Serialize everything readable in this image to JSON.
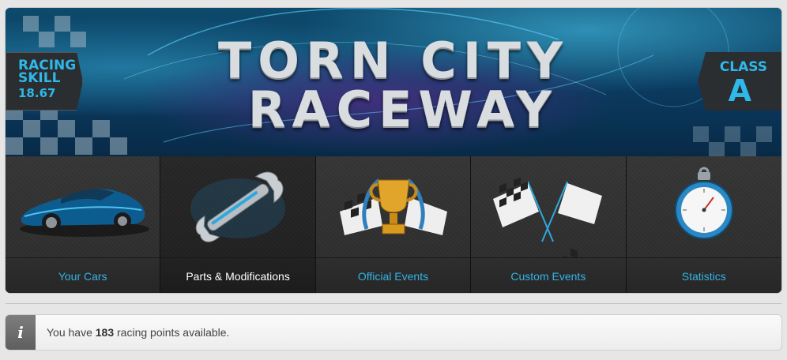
{
  "banner": {
    "title_line1": "TORN CITY",
    "title_line2": "RACEWAY",
    "skill_label": "RACING SKILL",
    "skill_value": "18.67",
    "class_label": "CLASS",
    "class_value": "A"
  },
  "nav": {
    "items": [
      {
        "label": "Your Cars",
        "icon": "race-car-icon",
        "active": false
      },
      {
        "label": "Parts & Modifications",
        "icon": "wrench-icon",
        "active": true
      },
      {
        "label": "Official Events",
        "icon": "trophy-icon",
        "active": false
      },
      {
        "label": "Custom Events",
        "icon": "checkered-flags-icon",
        "active": false
      },
      {
        "label": "Statistics",
        "icon": "stopwatch-icon",
        "active": false
      }
    ]
  },
  "info": {
    "icon": "info-icon",
    "icon_glyph": "i",
    "text_before": "You have ",
    "points": "183",
    "text_after": " racing points available."
  },
  "colors": {
    "accent": "#34b3e6",
    "active_label": "#ffffff",
    "panel_bg": "#2a2a2a"
  }
}
